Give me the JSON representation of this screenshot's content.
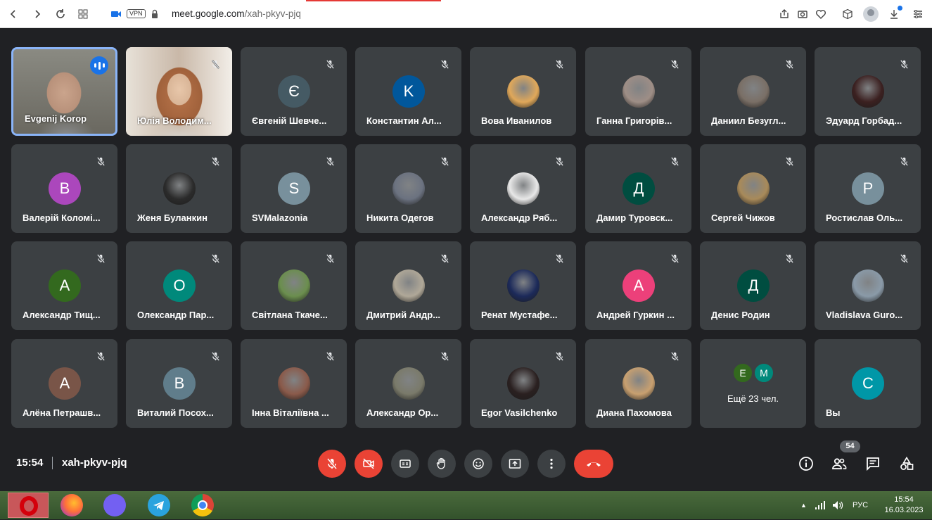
{
  "browser": {
    "vpn_label": "VPN",
    "url_host": "meet.google.com",
    "url_path": "/xah-pkyv-pjq"
  },
  "participants": [
    {
      "name": "Evgenij Korop",
      "type": "video",
      "active": true
    },
    {
      "name": "Юлія Володим...",
      "type": "video"
    },
    {
      "name": "Євгеній Шевче...",
      "initial": "Є",
      "color": "#455a64"
    },
    {
      "name": "Константин Ал...",
      "initial": "K",
      "color": "#01579b"
    },
    {
      "name": "Вова Иванилов",
      "photo": true,
      "color": "#e0a85a"
    },
    {
      "name": "Ганна Григорів...",
      "photo": true,
      "color": "#9e8e86"
    },
    {
      "name": "Даниил Безугл...",
      "photo": true,
      "color": "#7a6f66"
    },
    {
      "name": "Эдуард Горбад...",
      "photo": true,
      "color": "#3b2020"
    },
    {
      "name": "Валерій Коломі...",
      "initial": "B",
      "color": "#ab47bc"
    },
    {
      "name": "Женя Буланкин",
      "photo": true,
      "color": "#2b2b2b"
    },
    {
      "name": "SVMalazonia",
      "initial": "S",
      "color": "#78909c"
    },
    {
      "name": "Никита Одегов",
      "photo": true,
      "color": "#6b7280"
    },
    {
      "name": "Александр Ряб...",
      "photo": true,
      "color": "#e8e8e8"
    },
    {
      "name": "Дамир Туровск...",
      "initial": "Д",
      "color": "#004d40"
    },
    {
      "name": "Сергей Чижов",
      "photo": true,
      "color": "#a88a5a"
    },
    {
      "name": "Ростислав Оль...",
      "initial": "P",
      "color": "#78909c"
    },
    {
      "name": "Александр Тищ...",
      "initial": "A",
      "color": "#33691e"
    },
    {
      "name": "Олександр Пар...",
      "initial": "O",
      "color": "#00897b"
    },
    {
      "name": "Світлана Ткаче...",
      "photo": true,
      "color": "#6b8e4e"
    },
    {
      "name": "Дмитрий Андр...",
      "photo": true,
      "color": "#b0a898"
    },
    {
      "name": "Ренат Мустафе...",
      "photo": true,
      "color": "#1c2a5a"
    },
    {
      "name": "Андрей Гуркин ...",
      "initial": "A",
      "color": "#ec407a"
    },
    {
      "name": "Денис Родин",
      "initial": "Д",
      "color": "#004d40"
    },
    {
      "name": "Vladislava Guro...",
      "photo": true,
      "color": "#8a9aa8"
    },
    {
      "name": "Алёна Петрашв...",
      "initial": "A",
      "color": "#795548"
    },
    {
      "name": "Виталий Посох...",
      "initial": "B",
      "color": "#607d8b"
    },
    {
      "name": "Інна Віталіївна ...",
      "photo": true,
      "color": "#8a5a4a"
    },
    {
      "name": "Александр Ор...",
      "photo": true,
      "color": "#7a7a6a"
    },
    {
      "name": "Egor Vasilchenko",
      "photo": true,
      "color": "#2a2020"
    },
    {
      "name": "Диана Пахомова",
      "photo": true,
      "color": "#c8a070"
    },
    {
      "name": "Ещё 23 чел.",
      "type": "more",
      "more_initials": [
        "E",
        "M"
      ]
    },
    {
      "name": "Вы",
      "initial": "C",
      "color": "#0097a7",
      "self": true
    }
  ],
  "meeting": {
    "time": "15:54",
    "code": "xah-pkyv-pjq",
    "participants_count": "54"
  },
  "tray": {
    "language": "РУС",
    "time": "15:54",
    "date": "16.03.2023"
  }
}
